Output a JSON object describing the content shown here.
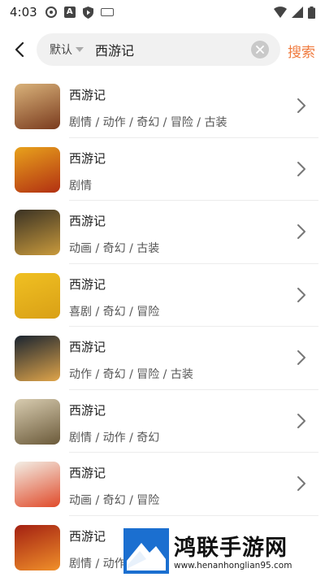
{
  "status_bar": {
    "time": "4:03",
    "left_icons": [
      "sync-ring-icon",
      "font-a-icon",
      "shield-icon",
      "keyboard-icon"
    ],
    "right_icons": [
      "wifi-icon",
      "signal-icon",
      "battery-icon"
    ]
  },
  "search": {
    "scope_label": "默认",
    "query": "西游记",
    "submit_label": "搜索",
    "accent_color": "#f07b3f"
  },
  "results": [
    {
      "title": "西游记",
      "tags": "剧情 / 动作 / 奇幻 / 冒险 / 古装",
      "poster_colors": [
        "#d9b27a",
        "#7a3b1e"
      ]
    },
    {
      "title": "西游记",
      "tags": "剧情",
      "poster_colors": [
        "#e8a21c",
        "#b23012"
      ]
    },
    {
      "title": "西游记",
      "tags": "动画 / 奇幻 / 古装",
      "poster_colors": [
        "#3a3224",
        "#c99a3c"
      ]
    },
    {
      "title": "西游记",
      "tags": "喜剧 / 奇幻 / 冒险",
      "poster_colors": [
        "#f0c022",
        "#d9a016"
      ]
    },
    {
      "title": "西游记",
      "tags": "动作 / 奇幻 / 冒险 / 古装",
      "poster_colors": [
        "#1a2430",
        "#e0a54a"
      ]
    },
    {
      "title": "西游记",
      "tags": "剧情 / 动作 / 奇幻",
      "poster_colors": [
        "#d8ccb0",
        "#6b5a3a"
      ]
    },
    {
      "title": "西游记",
      "tags": "动画 / 奇幻 / 冒险",
      "poster_colors": [
        "#f3efe6",
        "#e04a2a"
      ]
    },
    {
      "title": "西游记",
      "tags": "剧情 / 动作",
      "poster_colors": [
        "#a32012",
        "#f0902a"
      ]
    }
  ],
  "watermark": {
    "name": "鸿联手游网",
    "url": "www.henanhonglian95.com"
  }
}
